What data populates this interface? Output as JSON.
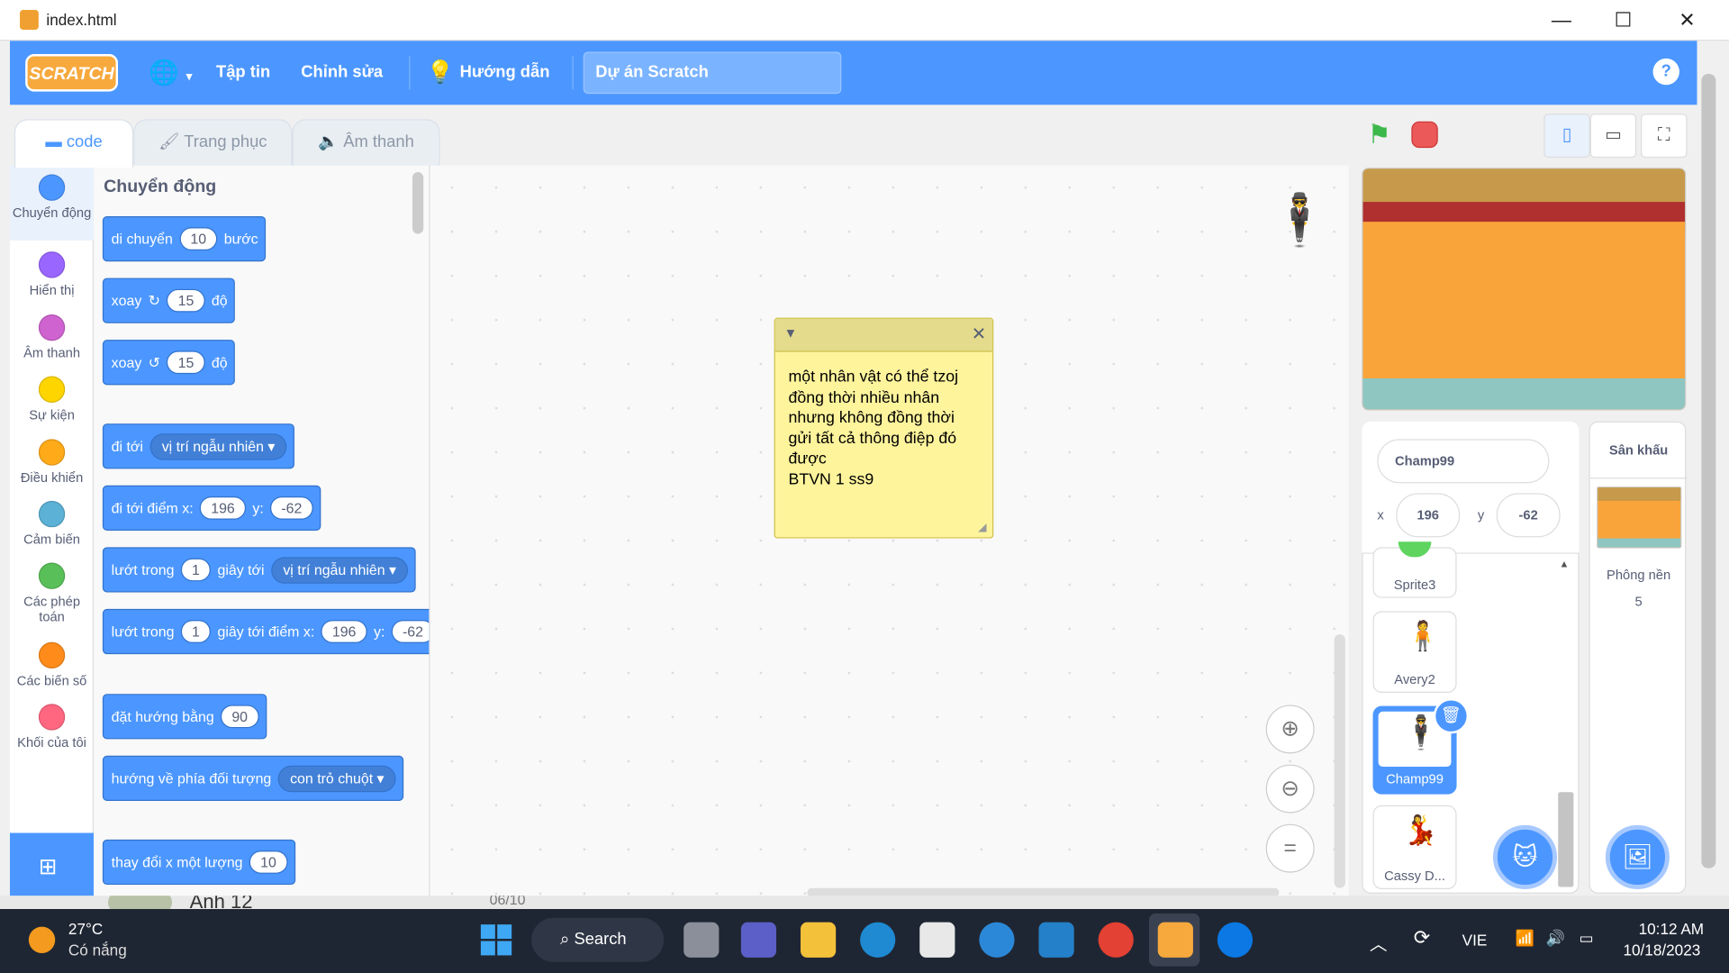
{
  "window": {
    "title": "index.html"
  },
  "menu": {
    "logo": "SCRATCH",
    "file": "Tập tin",
    "edit": "Chỉnh sửa",
    "tutorials": "Hướng dẫn",
    "project_title": "Dự án Scratch",
    "help": "?"
  },
  "tabs": {
    "code": "code",
    "costumes": "Trang phục",
    "sounds": "Âm thanh"
  },
  "categories": [
    {
      "label": "Chuyển động",
      "color": "#4c97ff"
    },
    {
      "label": "Hiển thị",
      "color": "#9966ff"
    },
    {
      "label": "Âm thanh",
      "color": "#cf63cf"
    },
    {
      "label": "Sự kiện",
      "color": "#ffd500"
    },
    {
      "label": "Điều khiển",
      "color": "#ffab19"
    },
    {
      "label": "Cảm biến",
      "color": "#5cb1d6"
    },
    {
      "label": "Các phép toán",
      "color": "#59c059"
    },
    {
      "label": "Các biến số",
      "color": "#ff8c1a"
    },
    {
      "label": "Khối của tôi",
      "color": "#ff6680"
    }
  ],
  "palette": {
    "heading": "Chuyển động",
    "b1": {
      "a": "di chuyển",
      "n": "10",
      "b": "bước"
    },
    "b2": {
      "a": "xoay",
      "n": "15",
      "b": "độ"
    },
    "b3": {
      "a": "xoay",
      "n": "15",
      "b": "độ"
    },
    "b4": {
      "a": "đi tới",
      "d": "vị trí ngẫu nhiên"
    },
    "b5": {
      "a": "đi tới điểm x:",
      "x": "196",
      "y_label": "y:",
      "y": "-62"
    },
    "b6": {
      "a": "lướt trong",
      "n": "1",
      "b": "giây tới",
      "d": "vị trí ngẫu nhiên"
    },
    "b7": {
      "a": "lướt trong",
      "n": "1",
      "b": "giây tới điểm x:",
      "x": "196",
      "y_label": "y:",
      "y": "-62"
    },
    "b8": {
      "a": "đặt hướng bằng",
      "n": "90"
    },
    "b9": {
      "a": "hướng về phía đối tượng",
      "d": "con trỏ chuột"
    },
    "b10": {
      "a": "thay đổi x một lượng",
      "n": "10"
    }
  },
  "note": {
    "text": "một nhân vật có thể tzoj\nđồng thời nhiều nhân\nnhưng không đồng thời\ngửi tất cả thông điệp đó\nđược\nBTVN 1 ss9"
  },
  "sprite_info": {
    "name": "Champ99",
    "x_label": "x",
    "x": "196",
    "y_label": "y",
    "y": "-62"
  },
  "sprites": [
    {
      "name": "Sprite3"
    },
    {
      "name": "Avery2"
    },
    {
      "name": "Champ99"
    },
    {
      "name": "Cassy D..."
    }
  ],
  "stage_panel": {
    "title": "Sân khấu",
    "backdrops_label": "Phông nền",
    "backdrops_count": "5"
  },
  "behind": {
    "name": "Anh 12",
    "date": "06/10"
  },
  "taskbar": {
    "temp": "27°C",
    "weather": "Có nắng",
    "search": "Search",
    "lang": "VIE",
    "time": "10:12 AM",
    "date": "10/18/2023"
  }
}
